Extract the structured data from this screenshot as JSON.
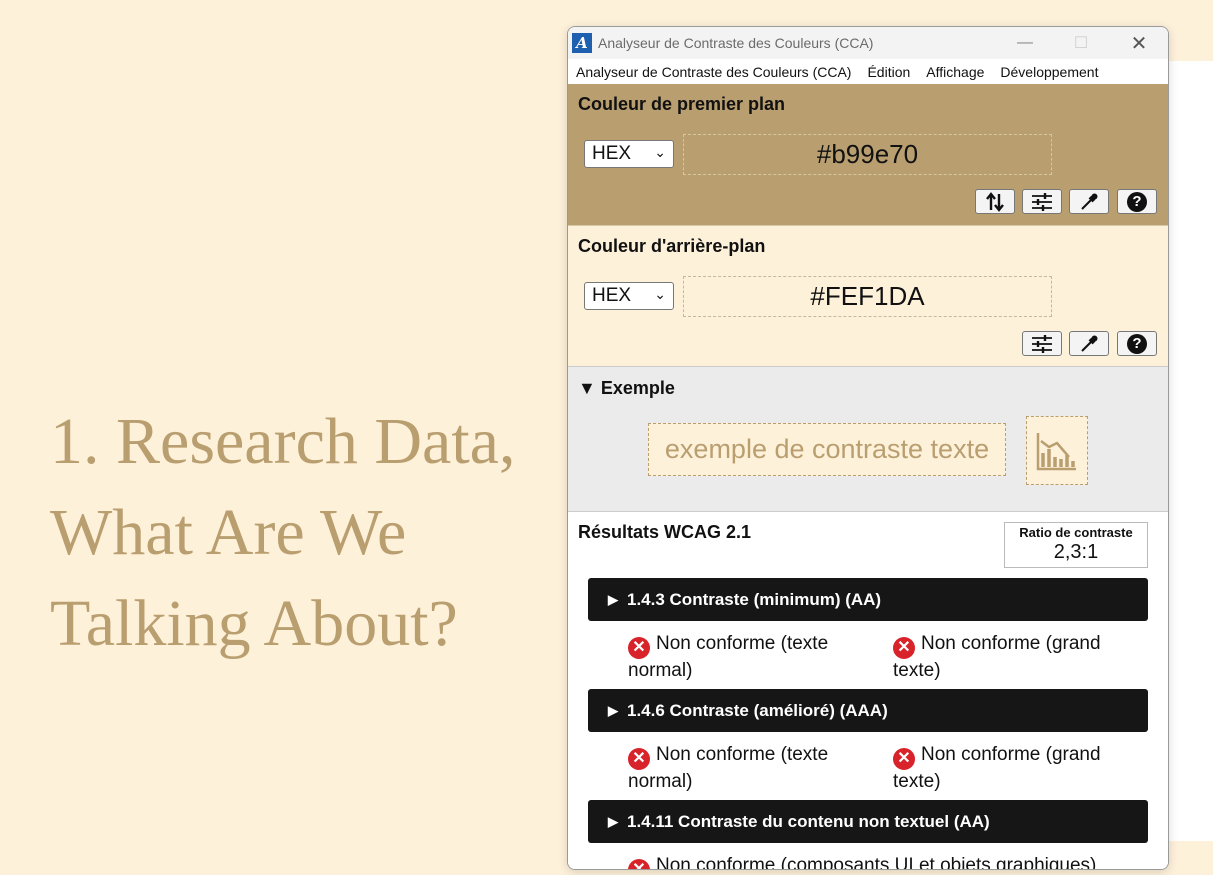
{
  "slide": {
    "title_lines": [
      "1. Research Data,",
      "What Are We",
      "Talking About?"
    ]
  },
  "window": {
    "title": "Analyseur de Contraste des Couleurs (CCA)",
    "controls": {
      "minimize": "—",
      "maximize": "☐",
      "close": "✕"
    }
  },
  "menu": {
    "items": [
      "Analyseur de Contraste des Couleurs (CCA)",
      "Édition",
      "Affichage",
      "Développement"
    ]
  },
  "foreground": {
    "heading": "Couleur de premier plan",
    "format": "HEX",
    "value": "#b99e70",
    "color": "#b99e70",
    "buttons": [
      "swap-icon",
      "sliders-icon",
      "eyedropper-icon",
      "help-icon"
    ]
  },
  "background": {
    "heading": "Couleur d'arrière-plan",
    "format": "HEX",
    "value": "#FEF1DA",
    "color": "#FEF1DA",
    "buttons": [
      "sliders-icon",
      "eyedropper-icon",
      "help-icon"
    ]
  },
  "example": {
    "heading": "Exemple",
    "toggle": "▼",
    "sample_text": "exemple de contraste texte"
  },
  "results": {
    "heading": "Résultats WCAG 2.1",
    "ratio_label": "Ratio de contraste",
    "ratio_value": "2,3:1",
    "criteria": [
      {
        "title": "1.4.3 Contraste (minimum) (AA)",
        "results": [
          "Non conforme (texte normal)",
          "Non conforme (grand texte)"
        ]
      },
      {
        "title": "1.4.6 Contraste (amélioré) (AAA)",
        "results": [
          "Non conforme (texte normal)",
          "Non conforme (grand texte)"
        ]
      },
      {
        "title": "1.4.11 Contraste du contenu non textuel (AA)",
        "results": [
          "Non conforme (composants UI et objets graphiques)"
        ]
      }
    ],
    "fail_color": "#d8232a"
  }
}
